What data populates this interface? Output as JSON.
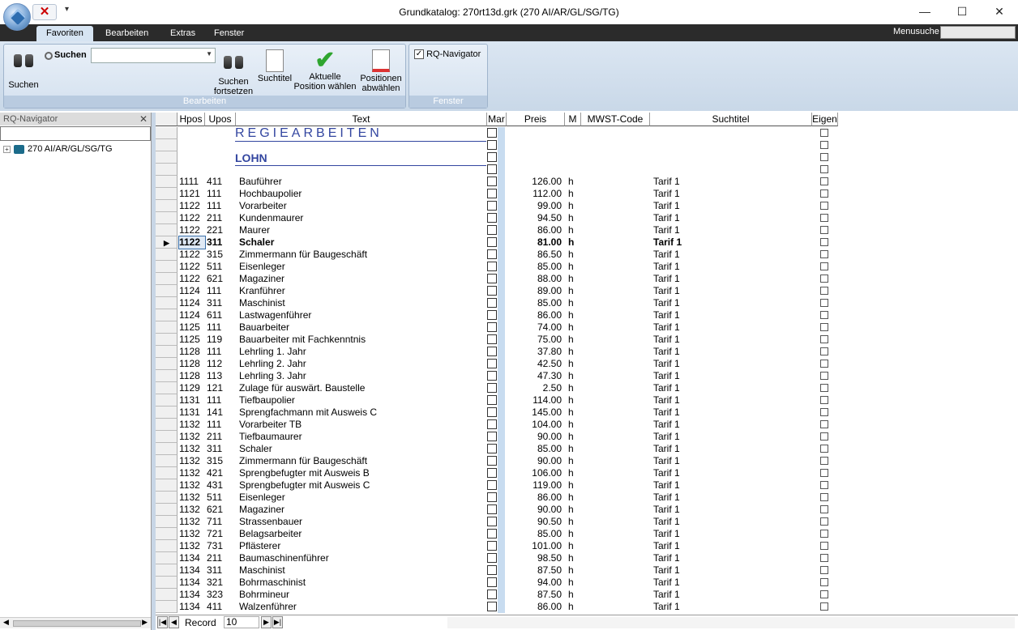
{
  "window": {
    "title": "Grundkatalog:  270rt13d.grk (270 AI/AR/GL/SG/TG)",
    "controls": [
      "—",
      "☐",
      "✕"
    ]
  },
  "tabs": [
    "Favoriten",
    "Bearbeiten",
    "Extras",
    "Fenster"
  ],
  "menu_search_label": "Menusuche",
  "ribbon": {
    "bearbeiten": {
      "group_label": "Bearbeiten",
      "suchen_big": "Suchen",
      "suchen_small": "Suchen",
      "suchen_fortsetzen": [
        "Suchen",
        "fortsetzen"
      ],
      "suchtitel": "Suchtitel",
      "aktuelle_position": [
        "Aktuelle",
        "Position wählen"
      ],
      "positionen_abwaehlen": [
        "Positionen",
        "abwählen"
      ]
    },
    "fenster": {
      "group_label": "Fenster",
      "rq_navigator": "RQ-Navigator"
    }
  },
  "sidebar": {
    "title": "RQ-Navigator",
    "close": "✕",
    "tree_item": "270 AI/AR/GL/SG/TG"
  },
  "grid": {
    "columns": [
      "Hpos",
      "Upos",
      "Text",
      "Mar",
      "Preis",
      "M",
      "MWST-Code",
      "Suchtitel",
      "Eigen"
    ],
    "section_title": "REGIEARBEITEN",
    "subsection_title": "LOHN",
    "rows": [
      [
        "1111",
        "411",
        "Bauführer",
        "126.00",
        "h",
        "Tarif 1"
      ],
      [
        "1121",
        "111",
        "Hochbaupolier",
        "112.00",
        "h",
        "Tarif 1"
      ],
      [
        "1122",
        "111",
        "Vorarbeiter",
        "99.00",
        "h",
        "Tarif 1"
      ],
      [
        "1122",
        "211",
        "Kundenmaurer",
        "94.50",
        "h",
        "Tarif 1"
      ],
      [
        "1122",
        "221",
        "Maurer",
        "86.00",
        "h",
        "Tarif 1"
      ],
      [
        "1122",
        "311",
        "Schaler",
        "81.00",
        "h",
        "Tarif 1"
      ],
      [
        "1122",
        "315",
        "Zimmermann für Baugeschäft",
        "86.50",
        "h",
        "Tarif 1"
      ],
      [
        "1122",
        "511",
        "Eisenleger",
        "85.00",
        "h",
        "Tarif 1"
      ],
      [
        "1122",
        "621",
        "Magaziner",
        "88.00",
        "h",
        "Tarif 1"
      ],
      [
        "1124",
        "111",
        "Kranführer",
        "89.00",
        "h",
        "Tarif 1"
      ],
      [
        "1124",
        "311",
        "Maschinist",
        "85.00",
        "h",
        "Tarif 1"
      ],
      [
        "1124",
        "611",
        "Lastwagenführer",
        "86.00",
        "h",
        "Tarif 1"
      ],
      [
        "1125",
        "111",
        "Bauarbeiter",
        "74.00",
        "h",
        "Tarif 1"
      ],
      [
        "1125",
        "119",
        "Bauarbeiter mit Fachkenntnis",
        "75.00",
        "h",
        "Tarif 1"
      ],
      [
        "1128",
        "111",
        "Lehrling 1. Jahr",
        "37.80",
        "h",
        "Tarif 1"
      ],
      [
        "1128",
        "112",
        "Lehrling 2. Jahr",
        "42.50",
        "h",
        "Tarif 1"
      ],
      [
        "1128",
        "113",
        "Lehrling 3. Jahr",
        "47.30",
        "h",
        "Tarif 1"
      ],
      [
        "1129",
        "121",
        "Zulage für auswärt. Baustelle",
        "2.50",
        "h",
        "Tarif 1"
      ],
      [
        "1131",
        "111",
        "Tiefbaupolier",
        "114.00",
        "h",
        "Tarif 1"
      ],
      [
        "1131",
        "141",
        "Sprengfachmann mit Ausweis C",
        "145.00",
        "h",
        "Tarif 1"
      ],
      [
        "1132",
        "111",
        "Vorarbeiter TB",
        "104.00",
        "h",
        "Tarif 1"
      ],
      [
        "1132",
        "211",
        "Tiefbaumaurer",
        "90.00",
        "h",
        "Tarif 1"
      ],
      [
        "1132",
        "311",
        "Schaler",
        "85.00",
        "h",
        "Tarif 1"
      ],
      [
        "1132",
        "315",
        "Zimmermann für Baugeschäft",
        "90.00",
        "h",
        "Tarif 1"
      ],
      [
        "1132",
        "421",
        "Sprengbefugter mit Ausweis B",
        "106.00",
        "h",
        "Tarif 1"
      ],
      [
        "1132",
        "431",
        "Sprengbefugter mit Ausweis C",
        "119.00",
        "h",
        "Tarif 1"
      ],
      [
        "1132",
        "511",
        "Eisenleger",
        "86.00",
        "h",
        "Tarif 1"
      ],
      [
        "1132",
        "621",
        "Magaziner",
        "90.00",
        "h",
        "Tarif 1"
      ],
      [
        "1132",
        "711",
        "Strassenbauer",
        "90.50",
        "h",
        "Tarif 1"
      ],
      [
        "1132",
        "721",
        "Belagsarbeiter",
        "85.00",
        "h",
        "Tarif 1"
      ],
      [
        "1132",
        "731",
        "Pflästerer",
        "101.00",
        "h",
        "Tarif 1"
      ],
      [
        "1134",
        "211",
        "Baumaschinenführer",
        "98.50",
        "h",
        "Tarif 1"
      ],
      [
        "1134",
        "311",
        "Maschinist",
        "87.50",
        "h",
        "Tarif 1"
      ],
      [
        "1134",
        "321",
        "Bohrmaschinist",
        "94.00",
        "h",
        "Tarif 1"
      ],
      [
        "1134",
        "323",
        "Bohrmineur",
        "87.50",
        "h",
        "Tarif 1"
      ],
      [
        "1134",
        "411",
        "Walzenführer",
        "86.00",
        "h",
        "Tarif 1"
      ]
    ],
    "selected_row_index": 5
  },
  "navigator": {
    "record_label": "Record",
    "record_value": "10"
  },
  "colors": {
    "tabbar": "#2b2b2b",
    "ribbon": "#d6e4f2",
    "section_text": "#3346a0",
    "check_green": "#2fa52f"
  }
}
